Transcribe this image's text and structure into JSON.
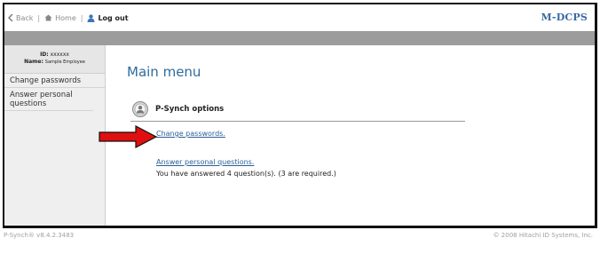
{
  "nav": {
    "back_label": "Back",
    "home_label": "Home",
    "logout_label": "Log out",
    "brand": "M-DCPS"
  },
  "sidebar": {
    "id_label": "ID:",
    "id_value": "xxxxxx",
    "name_label": "Name:",
    "name_value": "Sample Employee",
    "items": [
      {
        "label": "Change passwords"
      },
      {
        "label": "Answer personal questions"
      }
    ]
  },
  "main": {
    "title": "Main menu",
    "section_title": "P-Synch options",
    "change_link": "Change passwords.",
    "answer_link": "Answer personal questions.",
    "status_text": "You have answered 4 question(s). (3 are required.)"
  },
  "footer": {
    "version": "P-Synch® v8.4.2.3483",
    "copyright": "© 2008 Hitachi ID Systems, Inc."
  },
  "colors": {
    "accent_title": "#2e6b9e",
    "link": "#2b5f96",
    "brand": "#3a6aa3",
    "header_bar": "#9c9c9c",
    "arrow": "#e01010"
  },
  "icons": [
    "back-chevron-icon",
    "home-icon",
    "user-icon",
    "psynch-options-icon",
    "red-arrow-icon"
  ]
}
